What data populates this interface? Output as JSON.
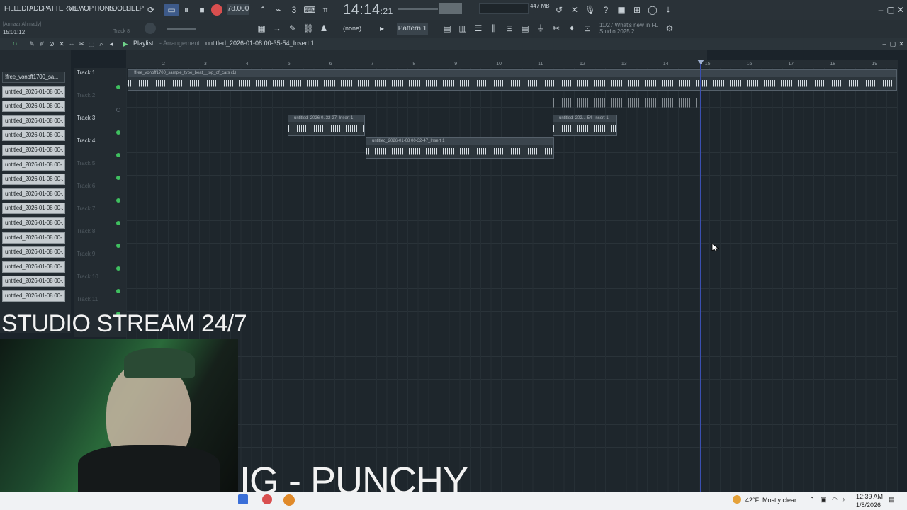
{
  "menu": [
    "FILE",
    "EDIT",
    "ADD",
    "PATTERNS",
    "VIEW",
    "OPTIONS",
    "TOOLS",
    "HELP"
  ],
  "transport": {
    "tempo": "78.000",
    "time_main": "14:14",
    "time_sub": "21",
    "memory": "447 MB",
    "snap": "(none)",
    "pattern": "Pattern 1"
  },
  "user": {
    "name": "[ArmaanAhmady]",
    "clock": "15:01:12",
    "hint": "Track 8"
  },
  "news": {
    "date": "11/27",
    "line1": "What's new in FL",
    "line2": "Studio 2025.2"
  },
  "playlist": {
    "title": "Playlist",
    "subtitle": "- Arrangement",
    "file": "untitled_2026-01-08 00-35-54_Insert 1"
  },
  "browser": {
    "items": [
      "!free_vonoff1700_sa...",
      "untitled_2026-01-08 00-...",
      "untitled_2026-01-08 00-...",
      "untitled_2026-01-08 00-...",
      "untitled_2026-01-08 00-...",
      "untitled_2026-01-08 00-...",
      "untitled_2026-01-08 00-...",
      "untitled_2026-01-08 00-...",
      "untitled_2026-01-08 00-...",
      "untitled_2026-01-08 00-...",
      "untitled_2026-01-08 00-...",
      "untitled_2026-01-08 00-...",
      "untitled_2026-01-08 00-...",
      "untitled_2026-01-08 00-...",
      "untitled_2026-01-08 00-...",
      "untitled_2026-01-08 00-..."
    ]
  },
  "tracks": [
    "Track 1",
    "Track 2",
    "Track 3",
    "Track 4",
    "Track 5",
    "Track 6",
    "Track 7",
    "Track 8",
    "Track 9",
    "Track 10",
    "Track 11"
  ],
  "ruler": [
    "2",
    "3",
    "4",
    "5",
    "6",
    "7",
    "8",
    "9",
    "10",
    "11",
    "12",
    "13",
    "14",
    "15",
    "16",
    "17",
    "18",
    "19"
  ],
  "clips": {
    "c1": "!free_vonoff1700_sample_type_beat__top_of_cars (1)",
    "c3a": "untitled_2026-0..32-27_Insert 1",
    "c3b": "untitled_202...-54_Insert 1",
    "c4": "untitled_2026-01-08 00-32-47_Insert 1"
  },
  "overlay": {
    "studio": "STUDIO STREAM 24/7",
    "ig": "IG - PUNCHY"
  },
  "taskbar": {
    "temp": "42°F",
    "weather": "Mostly clear",
    "time": "12:39 AM",
    "date": "1/8/2026"
  }
}
